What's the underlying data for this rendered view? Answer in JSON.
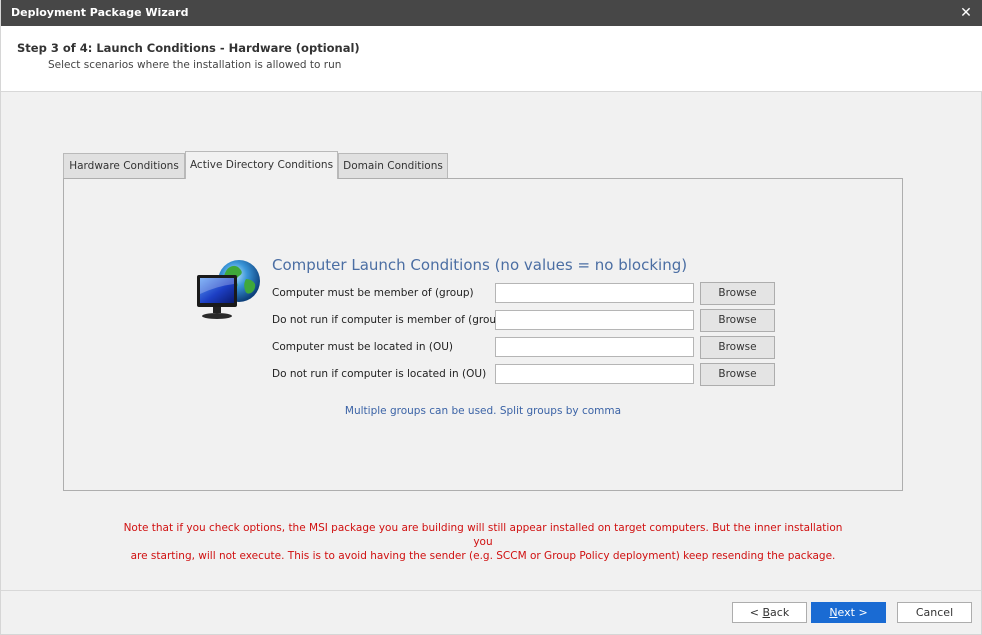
{
  "window": {
    "title": "Deployment Package Wizard",
    "close_icon": "close-icon"
  },
  "header": {
    "step": "Step 3 of 4: Launch Conditions - Hardware (optional)",
    "subtitle": "Select scenarios where the installation is allowed to run"
  },
  "tabs": [
    {
      "label": "Hardware Conditions",
      "active": false
    },
    {
      "label": "Active Directory Conditions",
      "active": true
    },
    {
      "label": "Domain Conditions",
      "active": false
    }
  ],
  "panel": {
    "icon": "computer-globe-icon",
    "title": "Computer Launch Conditions (no values = no blocking)",
    "rows": [
      {
        "label": "Computer must be member of (group)",
        "value": "",
        "button": "Browse"
      },
      {
        "label": "Do not run if computer is member of (group)",
        "value": "",
        "button": "Browse"
      },
      {
        "label": "Computer must be located in (OU)",
        "value": "",
        "button": "Browse"
      },
      {
        "label": "Do not run if computer is located in (OU)",
        "value": "",
        "button": "Browse"
      }
    ],
    "hint": "Multiple groups can be used. Split groups by comma"
  },
  "note": {
    "line1": "Note that if you check options, the MSI package you are building will still appear installed on target computers. But the inner installation you",
    "line2": "are starting, will not execute. This is to avoid having the sender (e.g. SCCM or Group Policy deployment) keep resending the package."
  },
  "footer": {
    "back_prefix": "< ",
    "back_mnemonic": "B",
    "back_rest": "ack",
    "next_mnemonic": "N",
    "next_rest": "ext >",
    "cancel": "Cancel"
  },
  "colors": {
    "titlebar": "#474747",
    "accent": "#1a6bd3",
    "section_title": "#4b6ea3",
    "hint": "#3b63a6",
    "warning": "#d01010"
  }
}
